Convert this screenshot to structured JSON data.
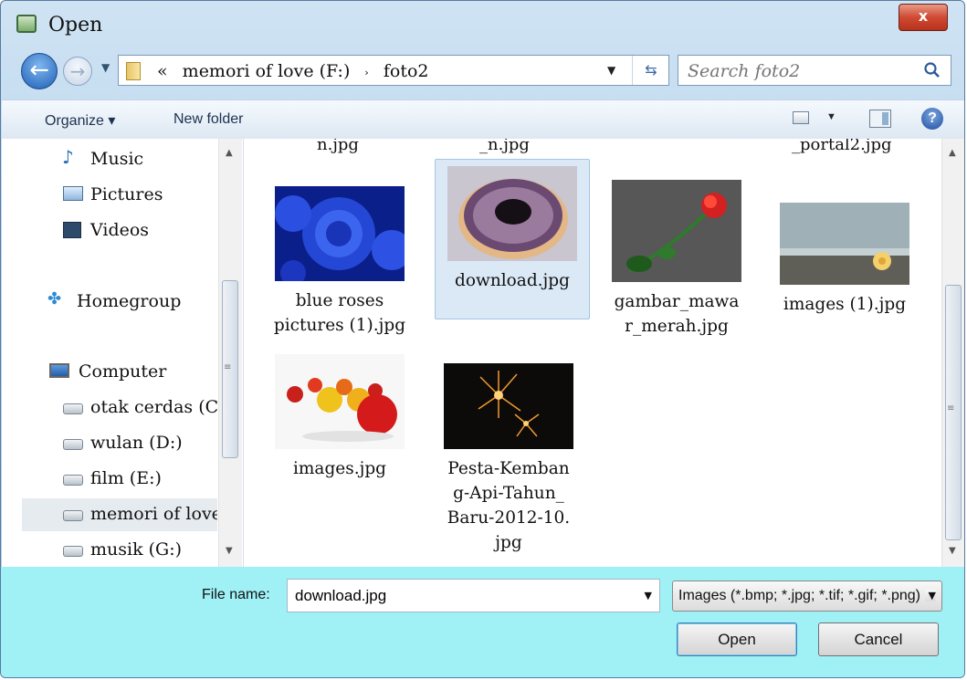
{
  "window": {
    "title": "Open",
    "close_glyph": "x"
  },
  "nav": {
    "back_icon": "back-arrow-icon",
    "forward_icon": "forward-arrow-icon",
    "address": {
      "overflow": "«",
      "drive": "memori of love (F:)",
      "folder": "foto2",
      "separator": "›"
    },
    "search_placeholder": "Search foto2"
  },
  "toolbar": {
    "organize": "Organize ▾",
    "new_folder": "New folder"
  },
  "sidebar": {
    "items": [
      {
        "label": "Music",
        "icon": "music-note-icon"
      },
      {
        "label": "Pictures",
        "icon": "pictures-folder-icon"
      },
      {
        "label": "Videos",
        "icon": "videos-folder-icon"
      },
      {
        "label": "Homegroup",
        "icon": "homegroup-icon"
      },
      {
        "label": "Computer",
        "icon": "computer-icon"
      },
      {
        "label": "otak cerdas (C",
        "icon": "drive-icon"
      },
      {
        "label": "wulan (D:)",
        "icon": "drive-icon"
      },
      {
        "label": "film (E:)",
        "icon": "drive-icon"
      },
      {
        "label": "memori of love",
        "icon": "drive-icon"
      },
      {
        "label": "musik (G:)",
        "icon": "drive-icon"
      }
    ]
  },
  "files": {
    "partial_top": [
      "n.jpg",
      "_n.jpg",
      "_portal2.jpg"
    ],
    "items": [
      {
        "name": "blue roses pictures (1).jpg",
        "thumb": "blue-rose"
      },
      {
        "name": "download.jpg",
        "thumb": "donut",
        "selected": true
      },
      {
        "name": "gambar_mawar_merah.jpg",
        "thumb": "red-rose"
      },
      {
        "name": "images (1).jpg",
        "thumb": "beach-flower"
      },
      {
        "name": "images.jpg",
        "thumb": "apples"
      },
      {
        "name": "Pesta-Kembang-Api-Tahun_Baru-2012-10.jpg",
        "thumb": "fireworks"
      }
    ]
  },
  "bottom": {
    "file_name_label": "File name:",
    "file_name_value": "download.jpg",
    "filter": "Images (*.bmp; *.jpg; *.tif; *.gif; *.png)",
    "open_label": "Open",
    "cancel_label": "Cancel"
  },
  "colors": {
    "bottom_panel": "#9ff1f5",
    "selection": "#dbe9f7",
    "close_button": "#cf4a33"
  }
}
